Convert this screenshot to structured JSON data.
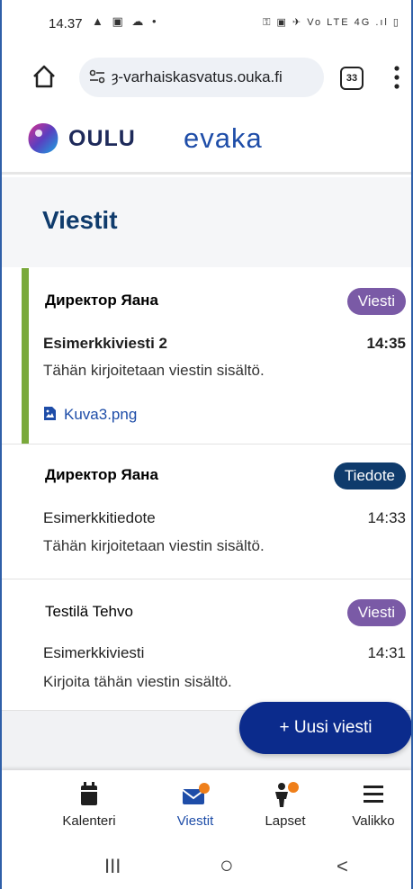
{
  "status_bar": {
    "time": "14.37",
    "left_icons": "▲ ▣ ☁ •",
    "right_icons": "⚿ ▣ ✈ Vo LTE 4G .ıl ▯"
  },
  "browser": {
    "url": "ȝ-varhaiskasvatus.ouka.fi",
    "tab_count": "33"
  },
  "header": {
    "brand": "OULU",
    "app": "evaka"
  },
  "page": {
    "title": "Viestit"
  },
  "messages": [
    {
      "sender": "Директор Яана",
      "badge": "Viesti",
      "subject": "Esimerkkiviesti 2",
      "time": "14:35",
      "body": "Tähän kirjoitetaan viestin sisältö.",
      "attachment": "Kuva3.png"
    },
    {
      "sender": "Директор Яана",
      "badge": "Tiedote",
      "subject": "Esimerkkitiedote",
      "time": "14:33",
      "body": "Tähän kirjoitetaan viestin sisältö."
    },
    {
      "sender": "Testilä Tehvo",
      "badge": "Viesti",
      "subject": "Esimerkkiviesti",
      "time": "14:31",
      "body": "Kirjoita tähän viestin sisältö."
    }
  ],
  "fab": {
    "label": "+ Uusi viesti"
  },
  "bottom_nav": [
    {
      "label": "Kalenteri"
    },
    {
      "label": "Viestit"
    },
    {
      "label": "Lapset"
    },
    {
      "label": "Valikko"
    }
  ],
  "system_nav": {
    "recents": "III",
    "home": "○",
    "back": "<"
  },
  "colors": {
    "primary": "#0f3b6c",
    "accent_blue": "#1e4da8",
    "viesti_badge": "#7a5aa6",
    "unread_bar": "#7aa93b",
    "fab": "#0b2b8c",
    "notification_dot": "#ef7f1a"
  }
}
